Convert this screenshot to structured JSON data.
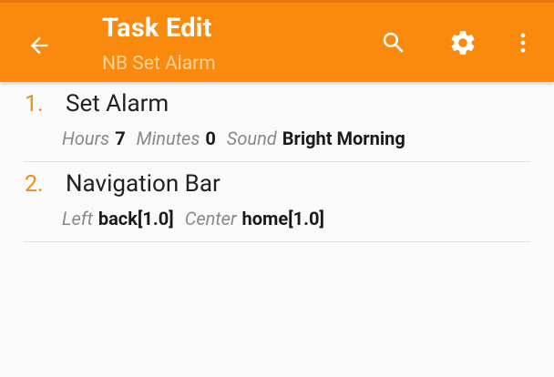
{
  "appbar": {
    "title": "Task Edit",
    "subtitle": "NB Set Alarm",
    "background_color": "#fa8a0e",
    "icons": {
      "back": "arrow-back-icon",
      "search": "search-icon",
      "settings": "gear-icon",
      "more": "more-vert-icon"
    }
  },
  "actions": [
    {
      "number": "1.",
      "name": "Set Alarm",
      "params": [
        {
          "key": "Hours",
          "value": "7"
        },
        {
          "key": "Minutes",
          "value": "0"
        },
        {
          "key": "Sound",
          "value": "Bright Morning"
        }
      ]
    },
    {
      "number": "2.",
      "name": "Navigation Bar",
      "params": [
        {
          "key": "Left",
          "value": "back[1.0]"
        },
        {
          "key": "Center",
          "value": "home[1.0]"
        }
      ]
    }
  ],
  "accent_color": "#f08c1a"
}
